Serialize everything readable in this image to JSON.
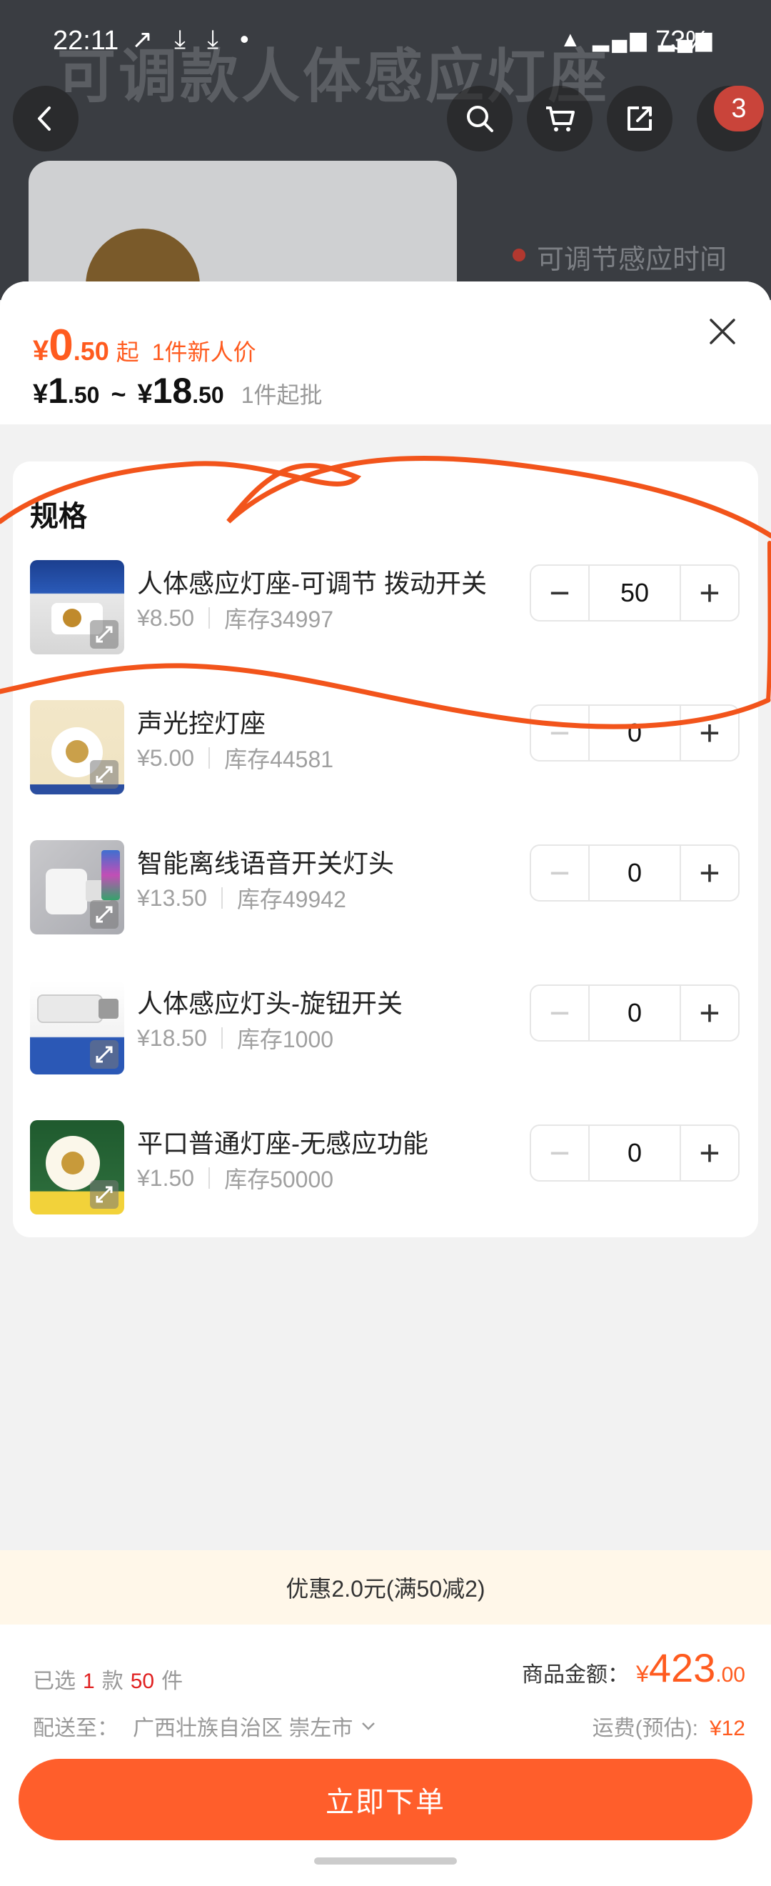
{
  "status_bar": {
    "time": "22:11",
    "left_icons": "↗ ⤓ ⤓ •",
    "signal": "▲ ▂▄▆ ▂▄▆",
    "battery": "73%"
  },
  "backdrop": {
    "banner": "可调款人体感应灯座",
    "note": "可调节感应时间",
    "cart_badge": "3"
  },
  "header": {
    "new_user_price": {
      "symbol": "¥",
      "int": "0",
      "dec": ".50",
      "suffix": "起",
      "note": "1件新人价"
    },
    "price_range": {
      "symbol_low": "¥",
      "low_int": "1",
      "low_dec": ".50",
      "tilde": "~",
      "symbol_high": "¥",
      "high_int": "18",
      "high_dec": ".50",
      "min_order": "1件起批"
    }
  },
  "spec": {
    "title": "规格",
    "items": [
      {
        "name": "人体感应灯座-可调节  拨动开关",
        "price": "¥8.50",
        "stock": "库存34997",
        "qty": "50"
      },
      {
        "name": "声光控灯座",
        "price": "¥5.00",
        "stock": "库存44581",
        "qty": "0"
      },
      {
        "name": "智能离线语音开关灯头",
        "price": "¥13.50",
        "stock": "库存49942",
        "qty": "0"
      },
      {
        "name": "人体感应灯头-旋钮开关",
        "price": "¥18.50",
        "stock": "库存1000",
        "qty": "0"
      },
      {
        "name": "平口普通灯座-无感应功能",
        "price": "¥1.50",
        "stock": "库存50000",
        "qty": "0"
      }
    ]
  },
  "promo": {
    "text": "优惠2.0元(满50减2)"
  },
  "footer": {
    "selected_prefix": "已选",
    "selected_kinds": "1",
    "kinds_unit": "款",
    "selected_count": "50",
    "count_unit": "件",
    "total_label": "商品金额：",
    "total_symbol": "¥",
    "total_int": "423",
    "total_dec": ".00",
    "ship_label": "配送至：",
    "ship_location": "广西壮族自治区 崇左市",
    "freight_label": "运费(预估):",
    "freight_value": "¥12",
    "order_button": "立即下单"
  },
  "colors": {
    "accent": "#ff5e2b",
    "price_orange": "#ff5b1f",
    "promo_bg": "#fff7e9",
    "annotation_red": "#f2541b"
  }
}
